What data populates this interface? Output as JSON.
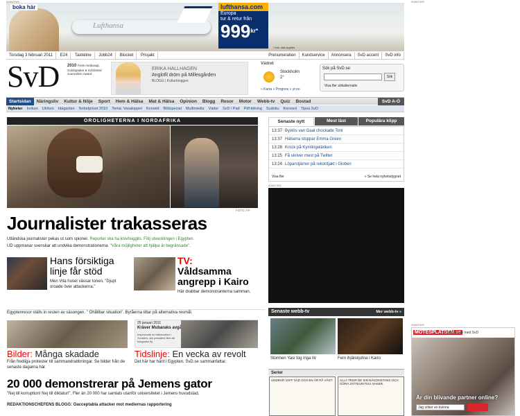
{
  "annons": "ANNONS",
  "banner": {
    "boka": "boka här",
    "brand": "lufthansa.com",
    "line1": "Europa",
    "line2": "tur & retur från",
    "price": "999",
    "kr": "kr*",
    "inkl": "* inkl. alla avgifter",
    "plane_text": "Lufthansa"
  },
  "datebar": {
    "date": "Torsdag 3 februari 2011",
    "items": [
      "E24",
      "Taxteline",
      "Jobb24",
      "Blocket",
      "Prisjakt"
    ],
    "right": [
      "Prenumeration",
      "Kundservice",
      "Annonsera",
      "SvD accent",
      "SvD info"
    ]
  },
  "logo": "SvD",
  "award": {
    "year": "2010",
    "text": "Årets mediasajt, Guldspaden & Schibsted Journalism Award"
  },
  "promo": {
    "name": "ERIKA HALLHAGEN",
    "title": "Anglofil dröm på Millesgården",
    "blog": "BLOGG | Kulturbloggen"
  },
  "weather": {
    "label": "Vädret",
    "city": "Stockholm",
    "temp": "2°",
    "links": "» Karta   » Prognos   » yr.no"
  },
  "search": {
    "label": "Sök på SvD.se:",
    "button": "Sök",
    "advanced": "Visa fler sökalternativ"
  },
  "nav": {
    "items": [
      "Startsidan",
      "Näringsliv",
      "Kultur & Nöje",
      "Sport",
      "Hem & Hälsa",
      "Mat & Hälsa",
      "Opinion",
      "Blogg",
      "Resor",
      "Motor",
      "Webb-tv",
      "Quiz",
      "Bostad"
    ],
    "ao": "SvD A-Ö"
  },
  "subnav": {
    "items": [
      "Nyheter",
      "Inrikes",
      "Utrikes",
      "Idagsidan",
      "Nobelpriset 2010",
      "Tema: Vasaloppet",
      "Korseld",
      "Bildspecial",
      "Multimedia",
      "Väder",
      "SvD i Pad",
      "Pdf-tidning",
      "Sudoku",
      "Korsord",
      "Tipsa SvD"
    ]
  },
  "main": {
    "kicker": "OROLIGHETERNA I NORDAFRIKA",
    "foto": "FOTO: AP",
    "headline": "Journalister trakasseras",
    "sub1a": "Utländska journalister pekas ut som spioner.",
    "sub1b": " Reporter ska ha knivhuggits. Följ utvecklingen i Egypten.",
    "sub2a": "UD uppmanar svenskar att undvika demonstrationerna.",
    "sub2b": " \"Våra möjligheter att hjälpa är begränsade\".",
    "obama_title": "Hans försiktiga linje får stöd",
    "obama_sub": "Men Vita huset vässar tonen. \"Djupt oroade över attackerna.\"",
    "kairo_tv": "TV:",
    "kairo_title": "Våldsamma angrepp i Kairo",
    "kairo_sub": "Här drabbar demonstranterna samman.",
    "egypt": "Egyptenresor ställs in resten av säsongen. \" Ohållbar situation\". Byråerna tittar på alternativa resmål.",
    "bilder_r": "Bilder:",
    "bilder_title": " Många skadade",
    "bilder_sub": "Från fredliga protester till sammandrabbningar. Se bilder från de senaste dagarna här.",
    "timeline_date": "25 januari 2011",
    "timeline_title": "Kräver Mubaraks avgång",
    "timeline_text": "Inspirerade av folkrevolten i Tunisien, där president Ben Ali tvingades fly",
    "tids_r": "Tidslinje:",
    "tids_title": " En vecka av revolt",
    "tids_sub": "Det här har hänt i Egypten. SvD.se sammanfattar.",
    "jemen": "20 000 demonstrerar på Jemens gator",
    "jemen_sub": "\"Nej till korruption! Nej till diktatur!\". Fler än 20 000 har samlats utanför universitetet i Jemens huvudstad.",
    "redak": "REDAKTIONSCHEFENS BLOGG: Oacceptabla attacker mot mediernas rapportering"
  },
  "tabs": [
    "Senaste nytt",
    "Mest läst",
    "Populära klipp"
  ],
  "news": [
    {
      "time": "13:37",
      "text": "Byxlös van Gaal chockade Toni"
    },
    {
      "time": "13:37",
      "text": "Hälsena stoppar Emma Green"
    },
    {
      "time": "13:28",
      "text": "Krock på Kymlingelänken"
    },
    {
      "time": "13:25",
      "text": "Få skriver mest på Twitter"
    },
    {
      "time": "13:24",
      "text": "Löparstjärnor på rekordjakt i Globen"
    }
  ],
  "news_more": "Visa fler",
  "news_all": "» Se hela nyhetsdygnet",
  "webbtv": {
    "title": "Senaste webb-tv",
    "more": "Mer webb-tv »",
    "v1": "Stormen Yasi tog inga liv",
    "v2": "Fem ihjälskjutna i Kairo"
  },
  "serier": "Serier",
  "comic1": "UNDRAR VAFF VAD OCH EN ÄR PÅ VÄG?",
  "comic2": "ALLA TROR DE SIN NÄGONSTANS OCH GÖRA JÄTTEVIKTIGA SAKER.",
  "motes": {
    "logo": "MÖTESPLATSEN.se",
    "text": "i samarbete med SvD",
    "q": "Är din blivande partner online?",
    "sel": "Jag söker en kvinna"
  }
}
